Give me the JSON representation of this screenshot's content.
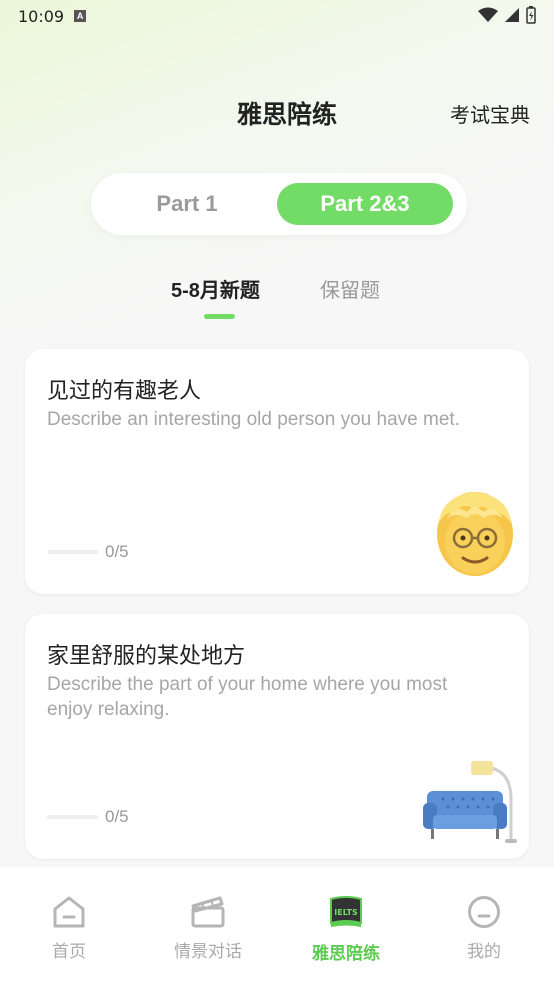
{
  "status": {
    "time": "10:09",
    "notif_badge": "A"
  },
  "header": {
    "title": "雅思陪练",
    "right_link": "考试宝典"
  },
  "segment": {
    "part1": "Part 1",
    "part23": "Part 2&3",
    "selected": "part23"
  },
  "subtabs": [
    {
      "label": "5-8月新题",
      "active": true
    },
    {
      "label": "保留题",
      "active": false
    }
  ],
  "cards": [
    {
      "title": "见过的有趣老人",
      "desc": "Describe an interesting old person you have met.",
      "progress": "0/5",
      "progress_fraction": 0,
      "icon": "old-man-emoji-icon"
    },
    {
      "title": "家里舒服的某处地方",
      "desc": "Describe the part of your home where you most enjoy relaxing.",
      "progress": "0/5",
      "progress_fraction": 0,
      "icon": "sofa-lamp-icon"
    }
  ],
  "tabbar": [
    {
      "label": "首页",
      "icon": "home-icon",
      "active": false
    },
    {
      "label": "情景对话",
      "icon": "clapperboard-icon",
      "active": false
    },
    {
      "label": "雅思陪练",
      "icon": "ielts-book-icon",
      "active": true
    },
    {
      "label": "我的",
      "icon": "profile-face-icon",
      "active": false
    }
  ],
  "colors": {
    "accent": "#72dc66",
    "accent_text": "#5ccb52"
  }
}
